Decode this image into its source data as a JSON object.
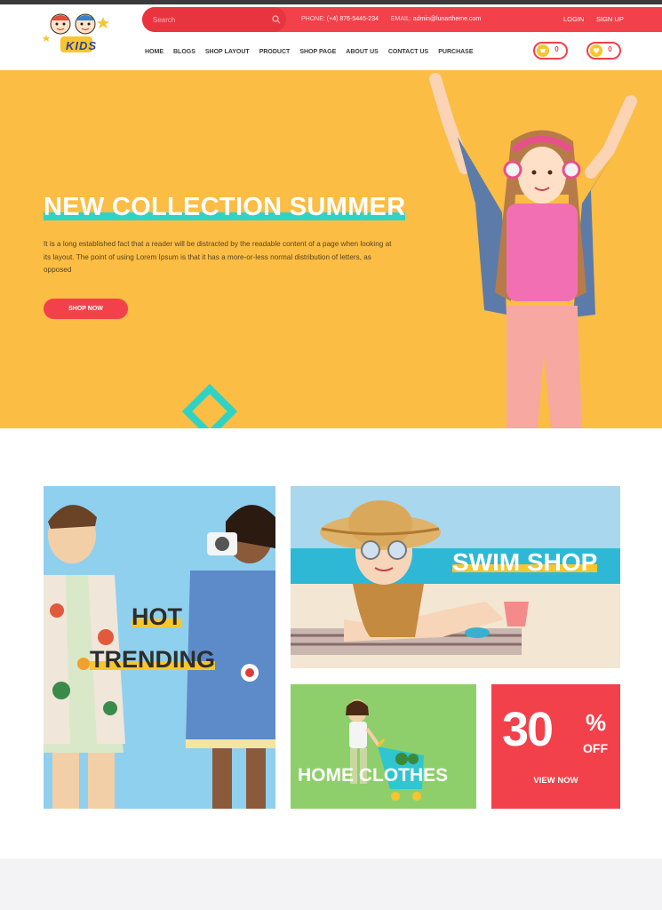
{
  "brand": {
    "logo_text": "KIDS",
    "icon": "kids-logo-icon"
  },
  "colors": {
    "accent": "#f2414a",
    "teal": "#2fd3c5",
    "hero_bg": "#fbbd43",
    "yellow": "#f7c62d"
  },
  "topbar": {
    "search_placeholder": "Search",
    "search_icon": "search-icon",
    "phone_label": "PHONE:",
    "phone_value": "(+4) 876-5445-234",
    "email_label": "EMAIL:",
    "email_value": "admin@lunartheme.com",
    "login": "LOGIN",
    "signup": "SIGN UP"
  },
  "nav": {
    "items": [
      {
        "label": "HOME",
        "active": true
      },
      {
        "label": "BLOGS"
      },
      {
        "label": "SHOP LAYOUT"
      },
      {
        "label": "PRODUCT"
      },
      {
        "label": "SHOP PAGE"
      },
      {
        "label": "ABOUT US"
      },
      {
        "label": "CONTACT US"
      },
      {
        "label": "PURCHASE"
      }
    ]
  },
  "header_icons": {
    "cart": {
      "icon": "cart-icon",
      "count": "0"
    },
    "wishlist": {
      "icon": "heart-icon",
      "count": "0"
    }
  },
  "hero": {
    "title": "NEW COLLECTION SUMMER",
    "text": "It is a long established fact that a reader will be distracted by the readable content of a page when looking at its layout. The point of using Lorem Ipsum is that it has a more-or-less normal distribution of letters, as opposed",
    "button": "SHOP NOW"
  },
  "banners": {
    "hot": {
      "line1": "HOT",
      "line2": "TRENDING"
    },
    "swim": {
      "label": "SWIM SHOP"
    },
    "home": {
      "label": "HOME CLOTHES"
    },
    "sale": {
      "percent": "30",
      "symbol": "%",
      "off": "OFF",
      "cta": "VIEW NOW"
    }
  }
}
